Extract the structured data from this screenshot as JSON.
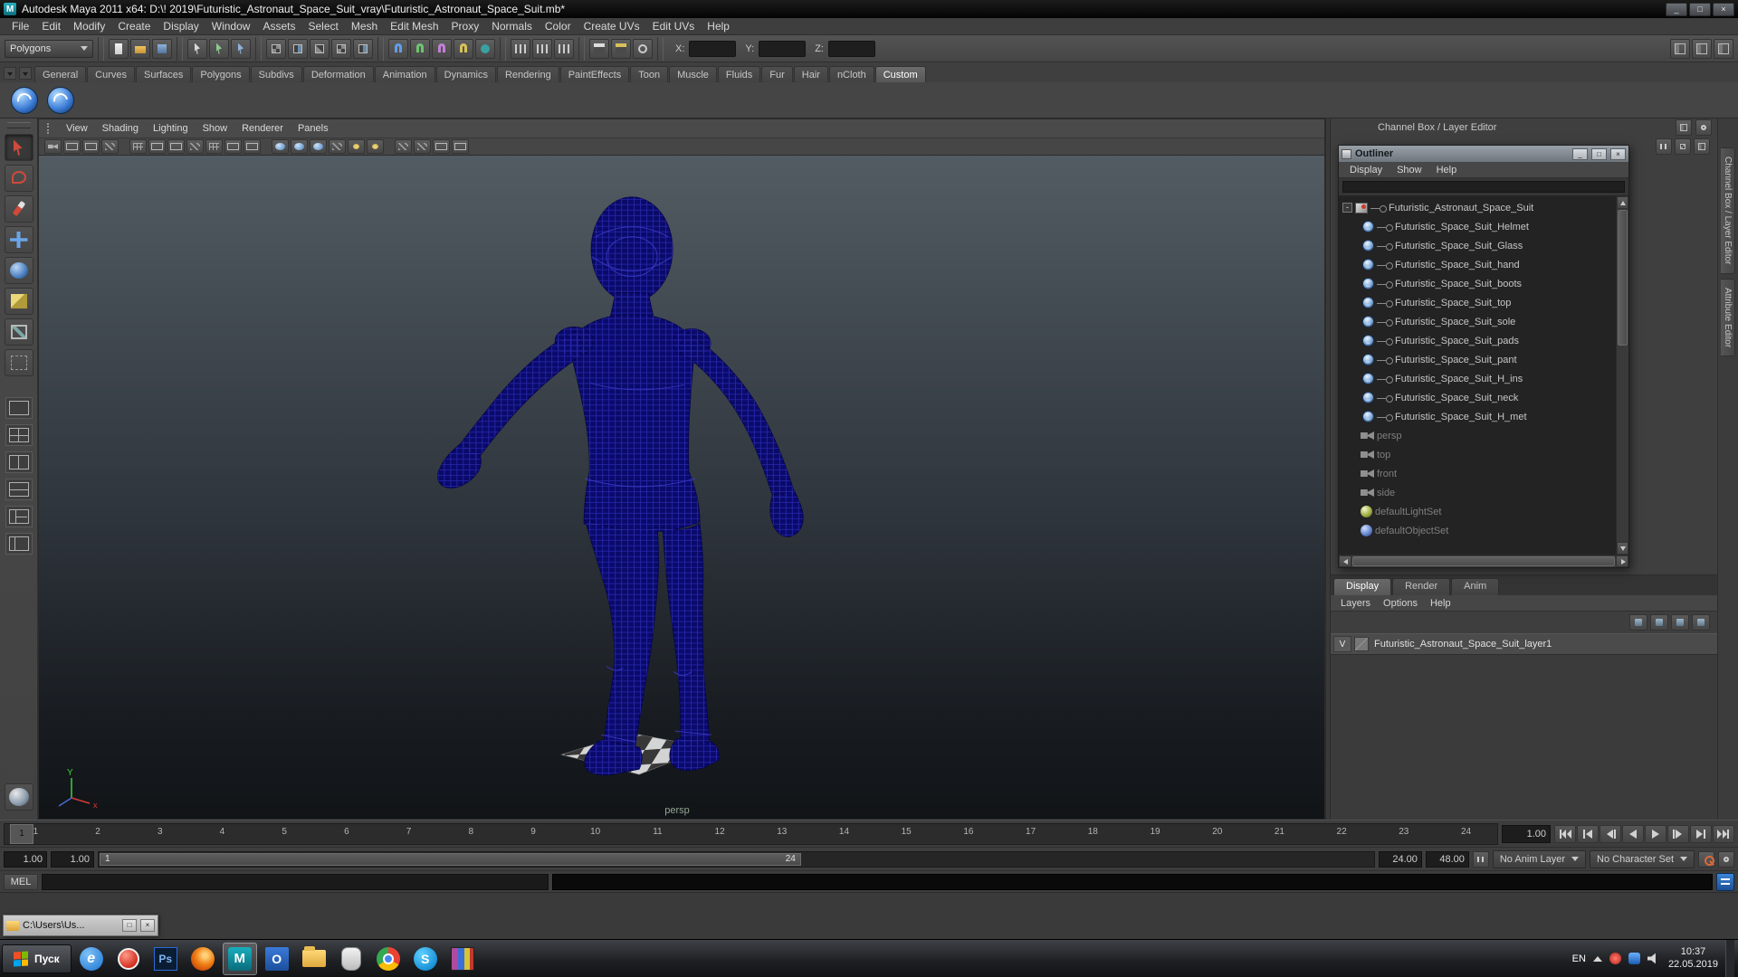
{
  "titlebar": {
    "app_icon": "M",
    "title": "Autodesk Maya 2011 x64: D:\\! 2019\\Futuristic_Astronaut_Space_Suit_vray\\Futuristic_Astronaut_Space_Suit.mb*",
    "minimize": "_",
    "maximize": "□",
    "close": "×"
  },
  "menubar": {
    "items": [
      "File",
      "Edit",
      "Modify",
      "Create",
      "Display",
      "Window",
      "Assets",
      "Select",
      "Mesh",
      "Edit Mesh",
      "Proxy",
      "Normals",
      "Color",
      "Create UVs",
      "Edit UVs",
      "Help"
    ]
  },
  "statusline": {
    "menuset": "Polygons",
    "x_label": "X:",
    "y_label": "Y:",
    "z_label": "Z:"
  },
  "shelf": {
    "tabs": [
      "General",
      "Curves",
      "Surfaces",
      "Polygons",
      "Subdivs",
      "Deformation",
      "Animation",
      "Dynamics",
      "Rendering",
      "PaintEffects",
      "Toon",
      "Muscle",
      "Fluids",
      "Fur",
      "Hair",
      "nCloth",
      "Custom"
    ],
    "active": "Custom"
  },
  "viewport": {
    "menus": [
      "View",
      "Shading",
      "Lighting",
      "Show",
      "Renderer",
      "Panels"
    ],
    "camera_label": "persp",
    "axis_y": "Y",
    "axis_x": "x"
  },
  "outliner": {
    "title": "Outliner",
    "minimize": "_",
    "maximize": "□",
    "close": "×",
    "menus": [
      "Display",
      "Show",
      "Help"
    ],
    "collapse_glyph": "-",
    "root": "Futuristic_Astronaut_Space_Suit",
    "children": [
      "Futuristic_Space_Suit_Helmet",
      "Futuristic_Space_Suit_Glass",
      "Futuristic_Space_Suit_hand",
      "Futuristic_Space_Suit_boots",
      "Futuristic_Space_Suit_top",
      "Futuristic_Space_Suit_sole",
      "Futuristic_Space_Suit_pads",
      "Futuristic_Space_Suit_pant",
      "Futuristic_Space_Suit_H_ins",
      "Futuristic_Space_Suit_neck",
      "Futuristic_Space_Suit_H_met"
    ],
    "cameras": [
      "persp",
      "top",
      "front",
      "side"
    ],
    "sets": [
      "defaultLightSet",
      "defaultObjectSet"
    ]
  },
  "right_panel": {
    "header": "Channel Box / Layer Editor",
    "side_tabs": [
      "Channel Box / Layer Editor",
      "Attribute Editor"
    ],
    "layer_editor": {
      "tabs": [
        "Display",
        "Render",
        "Anim"
      ],
      "active": "Display",
      "menus": [
        "Layers",
        "Options",
        "Help"
      ],
      "layer_visibility": "V",
      "layer_name": "Futuristic_Astronaut_Space_Suit_layer1"
    }
  },
  "timeline": {
    "frames": [
      "1",
      "2",
      "3",
      "4",
      "5",
      "6",
      "7",
      "8",
      "9",
      "10",
      "11",
      "12",
      "13",
      "14",
      "15",
      "16",
      "17",
      "18",
      "19",
      "20",
      "21",
      "22",
      "23",
      "24"
    ],
    "current_frame": "1",
    "current_time_field": "1.00"
  },
  "range_slider": {
    "playback_start": "1.00",
    "anim_start": "1.00",
    "bar_start_label": "1",
    "bar_end_label": "24",
    "playback_end": "24.00",
    "anim_end": "48.00",
    "anim_layer": "No Anim Layer",
    "character_set": "No Character Set"
  },
  "command_line": {
    "label": "MEL"
  },
  "folder_window": {
    "title": "C:\\Users\\Us...",
    "restore": "□",
    "close": "×"
  },
  "taskbar": {
    "start_label": "Пуск",
    "glyphs": {
      "ie": "e",
      "photoshop": "Ps",
      "maya": "M",
      "outlook": "O",
      "skype": "S"
    },
    "tray": {
      "lang": "EN",
      "time": "10:37",
      "date": "22.05.2019"
    }
  },
  "colors": {
    "wireframe_navy": "#0a0a6b",
    "viewport_top": "#535b63",
    "viewport_bottom": "#111417",
    "ui_gray": "#444444",
    "camera_label_green": "#93a893"
  }
}
